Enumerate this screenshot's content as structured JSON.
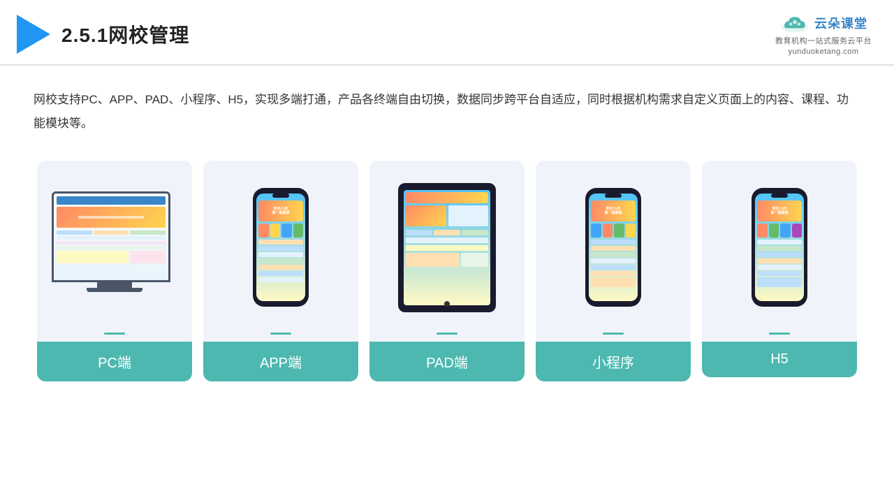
{
  "header": {
    "title": "2.5.1网校管理",
    "brand_name": "云朵课堂",
    "brand_url": "yunduoketang.com",
    "brand_tagline": "教育机构一站\n式服务云平台"
  },
  "description": "网校支持PC、APP、PAD、小程序、H5，实现多端打通，产品各终端自由切换，数据同步跨平台自适应，同时根据机构需求自定义页面上的内容、课程、功能模块等。",
  "cards": [
    {
      "id": "pc",
      "label": "PC端"
    },
    {
      "id": "app",
      "label": "APP端"
    },
    {
      "id": "pad",
      "label": "PAD端"
    },
    {
      "id": "miniapp",
      "label": "小程序"
    },
    {
      "id": "h5",
      "label": "H5"
    }
  ]
}
